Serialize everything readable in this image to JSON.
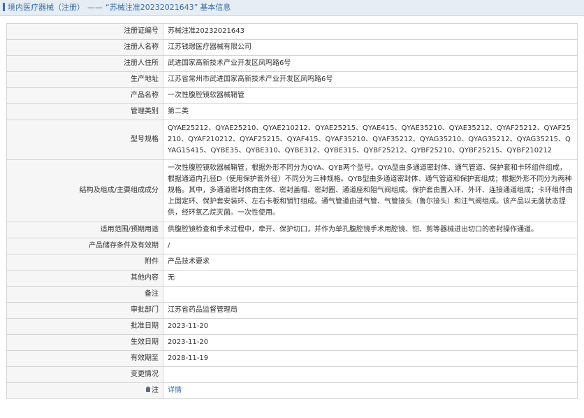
{
  "header": {
    "section": "境内医疗器械（注册）",
    "separator": "——",
    "reg_no_quoted": "“苏械注准20232021643”",
    "suffix": "基本信息"
  },
  "rows": [
    {
      "label": "注册证编号",
      "value": "苏械注准20232021643"
    },
    {
      "label": "注册人名称",
      "value": "江苏钱璟医疗器械有限公司"
    },
    {
      "label": "注册人住所",
      "value": "武进国家高新技术产业开发区凤鸣路6号"
    },
    {
      "label": "生产地址",
      "value": "江苏省常州市武进国家高新技术产业开发区凤鸣路6号"
    },
    {
      "label": "产品名称",
      "value": "一次性腹腔镜软器械鞘管"
    },
    {
      "label": "管理类别",
      "value": "第二类"
    },
    {
      "label": "型号规格",
      "value": "QYAE25212、QYAE25210、QYAE210212、QYAE25215、QYAE415、QYAE35210、QYAE35212、QYAF25212、QYAF25210、QYAF210212、QYAF25215、QYAF415、QYAF35210、QYAF35212、QYAG35210、QYAG35212、QYAG35215、QYAG15415、QYBE35、QYBE310、QYBE312、QYBE315、QYBF25212、QYBF25210、QYBF25215、QYBF210212"
    },
    {
      "label": "结构及组成/主要组成成分",
      "value": "一次性腹腔镜软器械鞘管，根据外形不同分为QYA、QYB两个型号。QYA型由多通道密封体、通气管道、保护套和卡环组件组成，根据通道内孔径D（使用保护套外径）不同分为三种规格。QYB型由多通道密封体、通气管道和保护套组成；根据外形不同分为两种规格。其中，多通道密封体由主体、密封盖帽、密封圈、通道座和阻气阀组成。保护套由置入环、外环、连接通道组成；卡环组件由上固定环、保护套安装环、左右卡板和销钉组成。通气管道由进气管、气管接头（鲁尔接头）和注气阀组成。该产品以无菌状态提供，经环氧乙烷灭菌。一次性使用。"
    },
    {
      "label": "适用范围/预期用途",
      "value": "供腹腔镜检查和手术过程中，牵开、保护切口，并作为单孔腹腔镜手术用腔镜、钳、剪等器械进出切口的密封操作通道。"
    },
    {
      "label": "产品储存条件及有效期",
      "value": "/"
    },
    {
      "label": "附件",
      "value": "产品技术要求"
    },
    {
      "label": "其他内容",
      "value": "无"
    },
    {
      "label": "备注",
      "value": ""
    },
    {
      "label": "审批部门",
      "value": "江苏省药品监督管理局"
    },
    {
      "label": "批准日期",
      "value": "2023-11-20"
    },
    {
      "label": "生效日期",
      "value": "2023-11-20"
    },
    {
      "label": "有效期至",
      "value": "2028-11-19"
    },
    {
      "label": "变更情况",
      "value": ""
    }
  ],
  "note_row": {
    "label": "注",
    "link": "详情"
  }
}
